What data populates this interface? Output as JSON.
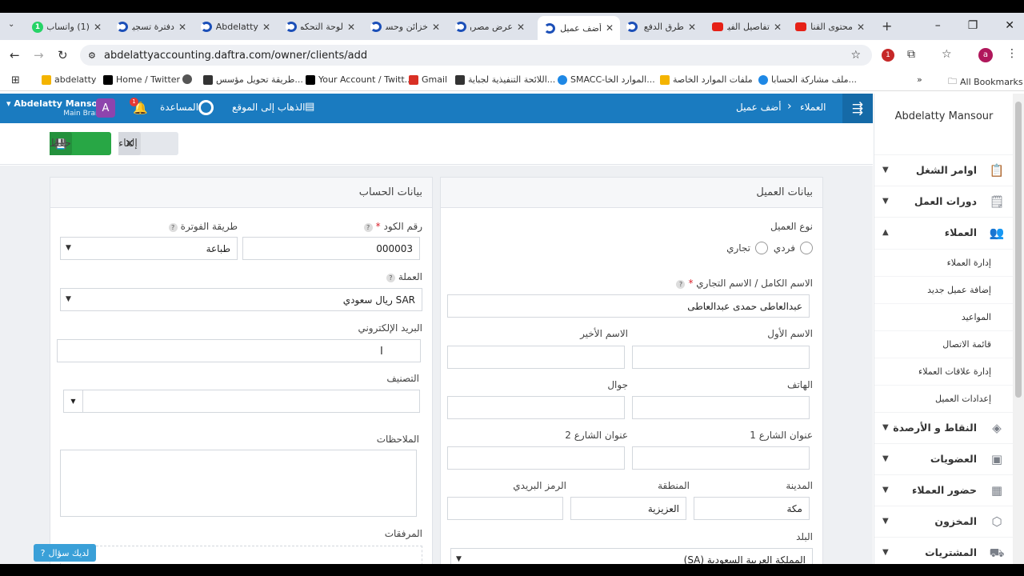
{
  "browser": {
    "tabs": [
      {
        "title": "(1) واتساب",
        "icon": "whatsapp-icon",
        "active": false
      },
      {
        "title": "دفترة تسجيل",
        "icon": "daftra-icon",
        "active": false
      },
      {
        "title": "Abdelatty",
        "icon": "daftra-icon",
        "active": false
      },
      {
        "title": "لوحة التحكم",
        "icon": "daftra-icon",
        "active": false
      },
      {
        "title": "خزائن وحسابات",
        "icon": "daftra-icon",
        "active": false
      },
      {
        "title": "عرض مصروف",
        "icon": "daftra-icon",
        "active": false
      },
      {
        "title": "أضف عميل",
        "icon": "daftra-icon",
        "active": true
      },
      {
        "title": "طرق الدفع",
        "icon": "daftra-icon",
        "active": false
      },
      {
        "title": "تفاصيل الفيديو",
        "icon": "youtube-icon",
        "active": false
      },
      {
        "title": "محتوى القناة",
        "icon": "youtube-icon",
        "active": false
      }
    ],
    "url": "abdelattyaccounting.daftra.com/owner/clients/add",
    "profile_letter": "a",
    "ext_badge": "1",
    "bookmarks": [
      {
        "label": "abdelatty",
        "icon": "windows-icon"
      },
      {
        "label": "Home / Twitter",
        "icon": "x-icon"
      },
      {
        "label": "",
        "icon": "globe-icon"
      },
      {
        "label": "طريقة تحويل مؤسس...",
        "icon": "page-icon"
      },
      {
        "label": "Your Account / Twitt...",
        "icon": "x-icon"
      },
      {
        "label": "Gmail",
        "icon": "gmail-icon"
      },
      {
        "label": "اللائحة التنفيذية لجباية...",
        "icon": "page-icon"
      },
      {
        "label": "SMACC-الموارد الخا...",
        "icon": "cloud-icon"
      },
      {
        "label": "ملفات الموارد الخاصة",
        "icon": "windows-icon"
      },
      {
        "label": "ملف مشاركة الحسابا...",
        "icon": "cloud-icon"
      }
    ],
    "all_bookmarks": "All Bookmarks"
  },
  "header": {
    "user_name": "Abdelatty Mansour",
    "branch": "Main Branch",
    "avatar_letter": "A",
    "notif_count": "1",
    "help_label": "المساعدة",
    "goto_site": "الذهاب إلى الموقع",
    "breadcrumb_root": "العملاء",
    "breadcrumb_sep": "›",
    "breadcrumb_current": "أضف عميل"
  },
  "toolbar": {
    "save_label": "حفظ",
    "cancel_label": "إلغاء"
  },
  "client_panel": {
    "title": "بيانات العميل",
    "type_label": "نوع العميل",
    "type_individual": "فردي",
    "type_business": "تجاري",
    "fullname_label": "الاسم الكامل / الاسم التجاري",
    "fullname_value": "عبدالعاطى حمدى عبدالعاطى",
    "first_name_label": "الاسم الأول",
    "last_name_label": "الاسم الأخير",
    "phone_label": "الهاتف",
    "mobile_label": "جوال",
    "street1_label": "عنوان الشارع 1",
    "street2_label": "عنوان الشارع 2",
    "city_label": "المدينة",
    "city_value": "مكة",
    "region_label": "المنطقة",
    "region_value": "العزيزية",
    "postal_label": "الرمز البريدي",
    "country_label": "البلد",
    "country_value": "المملكة العربية السعودية (SA)"
  },
  "account_panel": {
    "title": "بيانات الحساب",
    "code_label": "رقم الكود",
    "code_value": "000003",
    "invoice_method_label": "طريقة الفوترة",
    "invoice_method_value": "طباعة",
    "currency_label": "العملة",
    "currency_value": "SAR ريال سعودي",
    "email_label": "البريد الإلكتروني",
    "category_label": "التصنيف",
    "notes_label": "الملاحظات",
    "attachments_label": "المرفقات"
  },
  "sidebar": {
    "user_name": "Abdelatty Mansour",
    "items": [
      {
        "label": "اوامر الشغل",
        "icon": "clipboard-icon",
        "expanded": false
      },
      {
        "label": "دورات العمل",
        "icon": "clipboard-list-icon",
        "expanded": false
      },
      {
        "label": "العملاء",
        "icon": "users-icon",
        "expanded": true
      }
    ],
    "sub_items": [
      "إدارة العملاء",
      "إضافة عميل جديد",
      "المواعيد",
      "قائمة الاتصال",
      "إدارة علاقات العملاء",
      "إعدادات العميل"
    ],
    "items_after": [
      {
        "label": "النقاط و الأرصدة",
        "icon": "layers-icon"
      },
      {
        "label": "العضويات",
        "icon": "id-card-icon"
      },
      {
        "label": "حضور العملاء",
        "icon": "calendar-icon"
      },
      {
        "label": "المخزون",
        "icon": "box-icon"
      },
      {
        "label": "المشتريات",
        "icon": "truck-icon"
      }
    ]
  },
  "help_widget": "لديك سؤال"
}
